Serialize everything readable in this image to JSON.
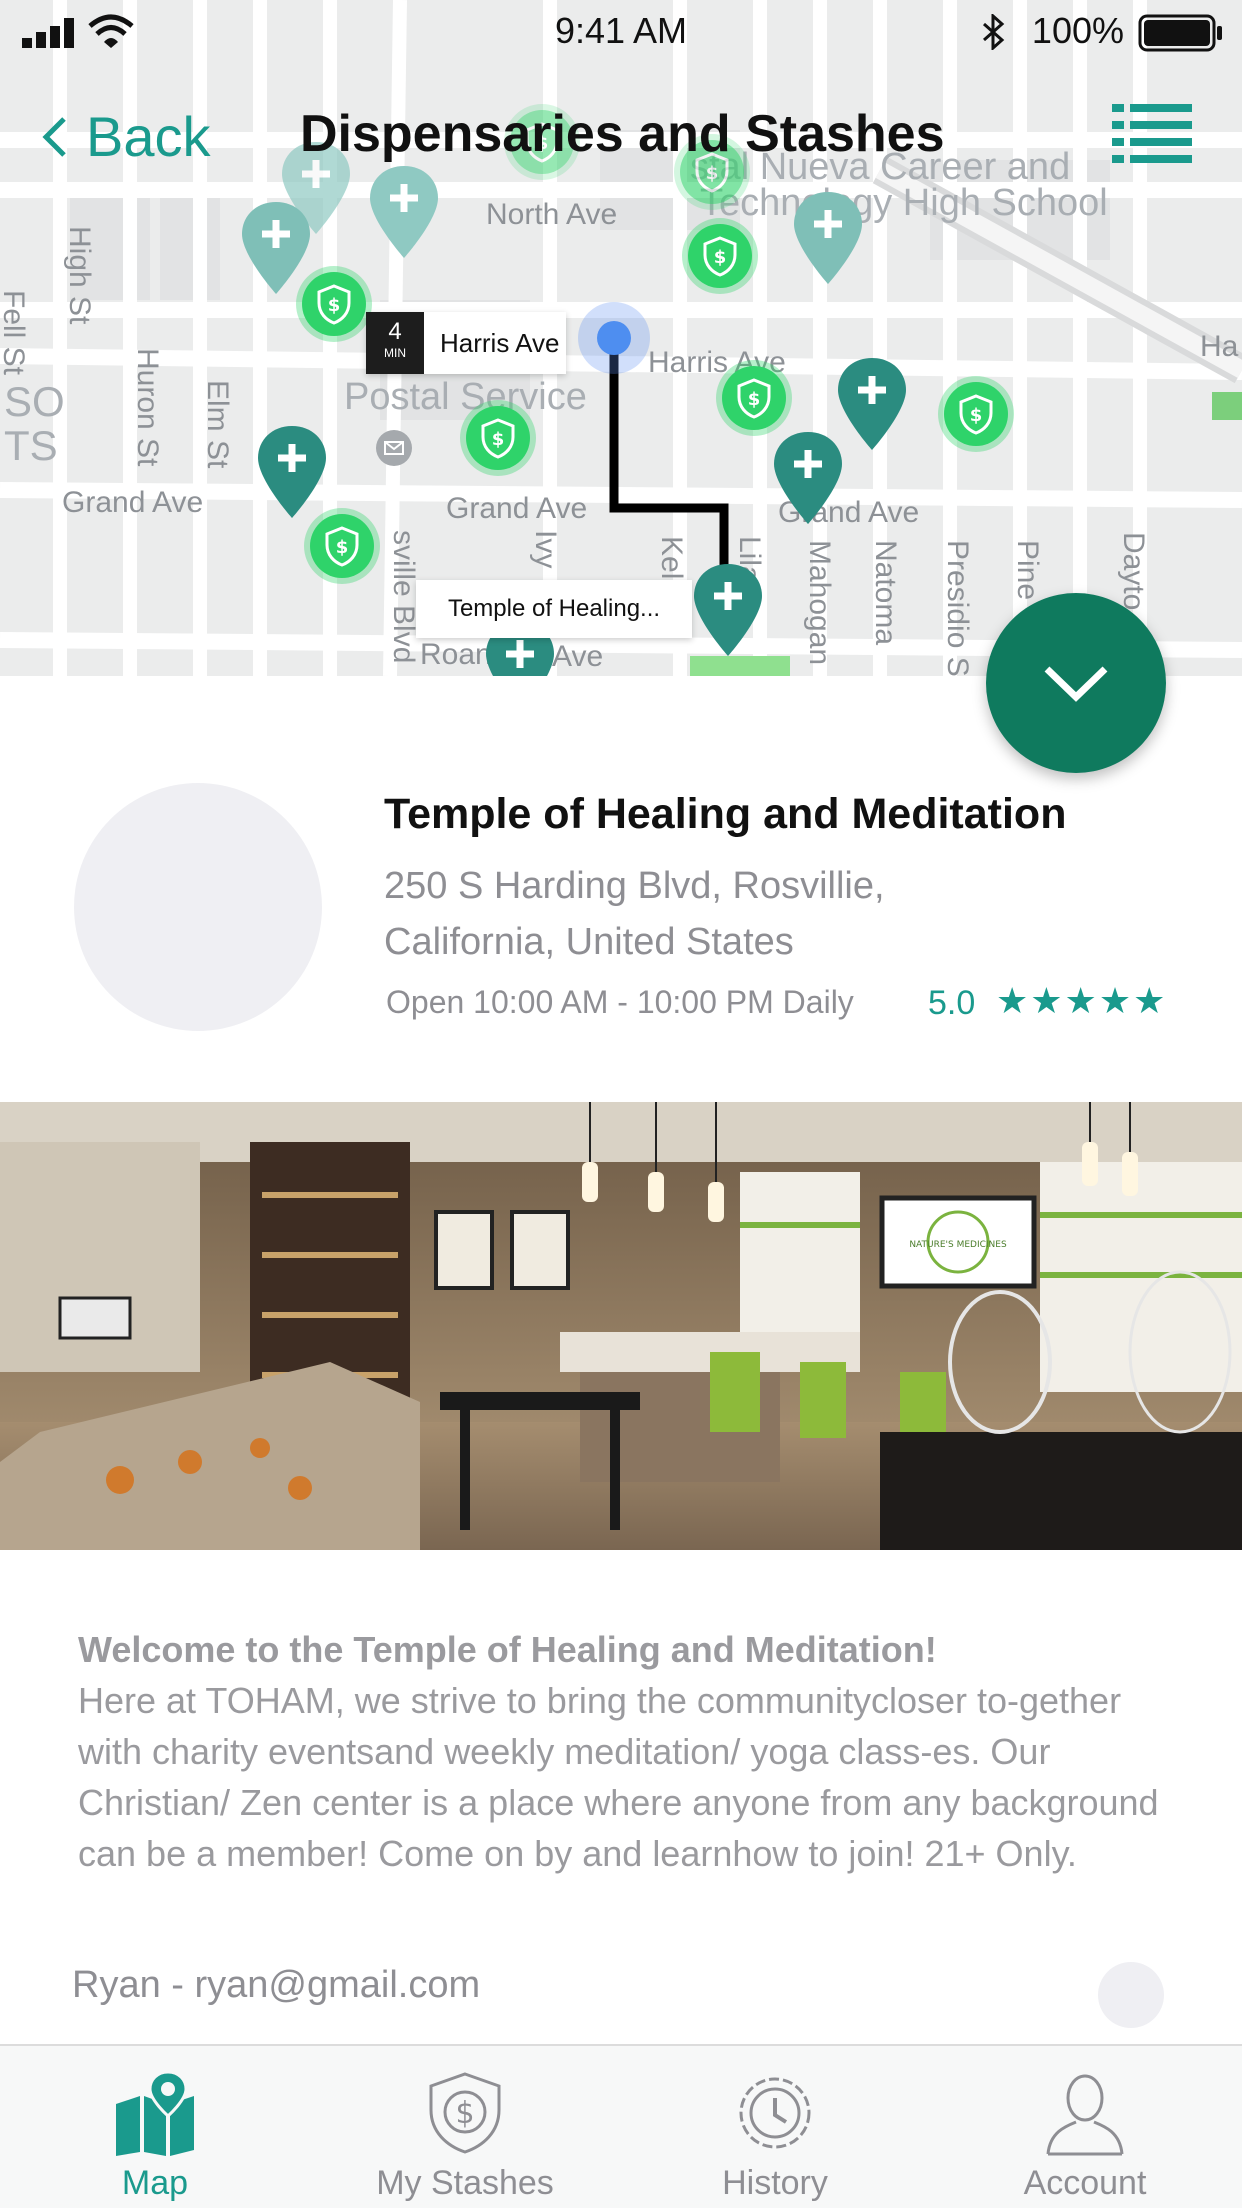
{
  "status_bar": {
    "time": "9:41 AM",
    "battery": "100%"
  },
  "nav": {
    "back_label": "Back",
    "title": "Dispensaries and Stashes"
  },
  "map": {
    "streets": {
      "north": "North Ave",
      "grand1": "Grand Ave",
      "grand2": "Grand Ave",
      "grand3": "Grand Ave",
      "harris": "Harris Ave",
      "roan": "Roan",
      "roan_ave": "Ave",
      "high": "High St",
      "huron": "Huron St",
      "elm": "Elm St",
      "fell": "Fell St",
      "ivy": "Ivy",
      "mahogany": "Mahogan",
      "natoma": "Natoma",
      "presidio": "Presidio S",
      "pine": "Pine",
      "dayto": "Dayto",
      "lilac": "Lilac",
      "kel": "Kel",
      "ville": "sville Blvd",
      "ha": "Ha"
    },
    "pois": {
      "postal": "Postal Service",
      "school": "Technology High School",
      "career": "stal Nueva Career and",
      "so": "SO",
      "ts": "TS"
    },
    "eta": {
      "value": "4",
      "unit": "MIN",
      "street": "Harris Ave"
    },
    "callout": "Temple of Healing..."
  },
  "place": {
    "name": "Temple of Healing and Meditation",
    "address": "250 S Harding Blvd, Rosvillie, California, United States",
    "hours": "Open 10:00 AM - 10:00 PM Daily",
    "rating": "5.0",
    "stars": "★★★★★",
    "photo_screen_text": "NATURE'S MEDICINES"
  },
  "description": {
    "heading": "Welcome to the Temple of Healing and Meditation!",
    "body": "Here at TOHAM, we strive to bring the communitycloser to-gether with charity eventsand weekly meditation/ yoga class-es. Our Christian/ Zen center is a place where anyone from any background can be a member! Come on by and learnhow to join! 21+ Only."
  },
  "contact": "Ryan - ryan@gmail.com",
  "tabs": [
    {
      "label": "Map",
      "icon": "map-pin-icon",
      "active": true
    },
    {
      "label": "My Stashes",
      "icon": "stash-shield-icon",
      "active": false
    },
    {
      "label": "History",
      "icon": "history-clock-icon",
      "active": false
    },
    {
      "label": "Account",
      "icon": "account-person-icon",
      "active": false
    }
  ],
  "colors": {
    "accent": "#1a9a8d",
    "fab": "#0f7a5e",
    "stash": "#2fd36a",
    "pin": "#2b8c80"
  }
}
